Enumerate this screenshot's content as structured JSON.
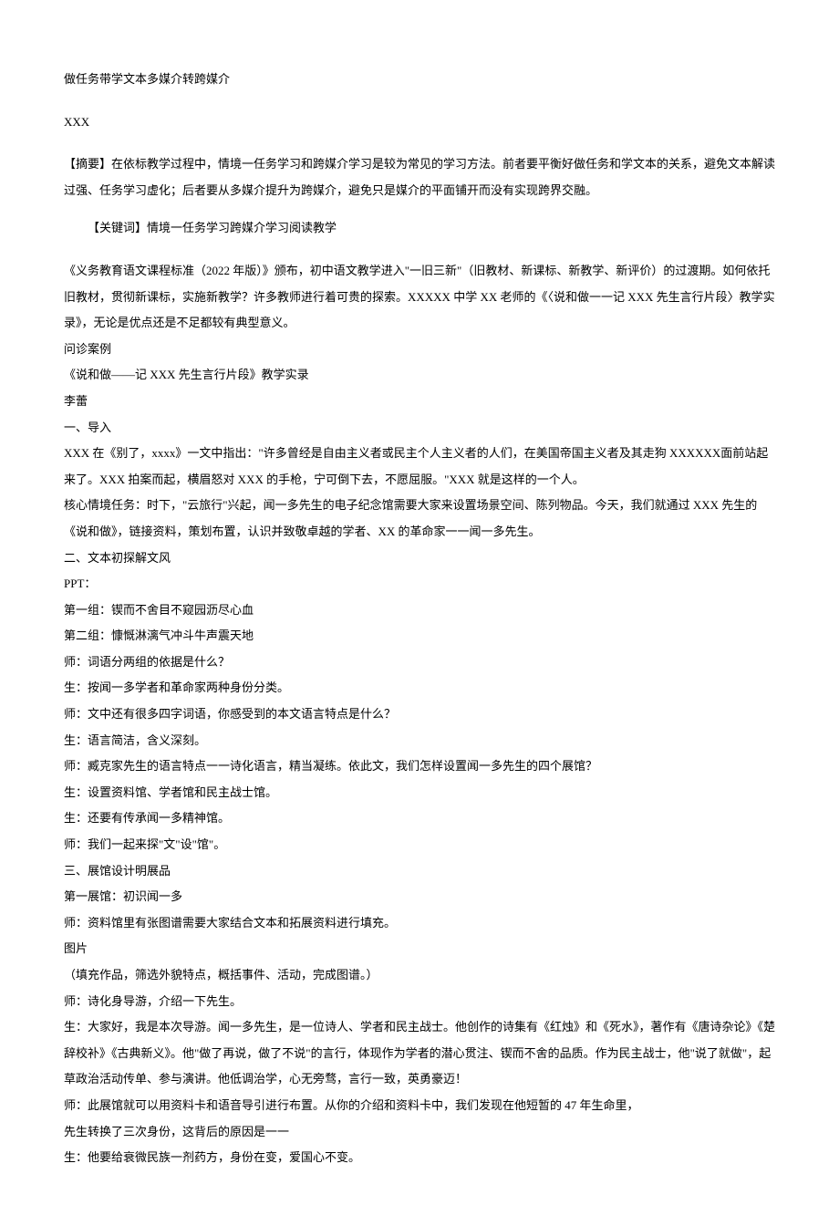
{
  "title": "做任务带学文本多媒介转跨媒介",
  "author": "XXX",
  "abstract": "【摘要】在依标教学过程中，情境一任务学习和跨媒介学习是较为常见的学习方法。前者要平衡好做任务和学文本的关系，避免文本解读过强、任务学习虚化；后者要从多媒介提升为跨媒介，避免只是媒介的平面铺开而没有实现跨界交融。",
  "keywords": "【关键词】情境一任务学习跨媒介学习阅读教学",
  "body": [
    "《义务教育语文课程标准（2022 年版）》颁布，初中语文教学进入\"一旧三新\"（旧教材、新课标、新教学、新评价）的过渡期。如何依托旧教材，贯彻新课标，实施新教学？许多教师进行着可贵的探索。XXXXX 中学 XX 老师的《〈说和做一一记 XXX 先生言行片段〉教学实录》，无论是优点还是不足都较有典型意义。",
    "问诊案例",
    "《说和做——记 XXX 先生言行片段》教学实录",
    "李蕾",
    "一、导入",
    "XXX 在《别了，xxxx》一文中指出：\"许多曾经是自由主义者或民主个人主义者的人们，在美国帝国主义者及其走狗 XXXXXX面前站起来了。XXX 拍案而起，横眉怒对 XXX 的手枪，宁可倒下去，不愿屈服。\"XXX 就是这样的一个人。",
    "核心情境任务：时下，\"云旅行\"兴起，闻一多先生的电子纪念馆需要大家来设置场景空间、陈列物品。今天，我们就通过 XXX 先生的《说和做》，链接资料，策划布置，认识并致敬卓越的学者、XX 的革命家一一闻一多先生。",
    "二、文本初探解文风",
    "PPT：",
    "第一组：锲而不舍目不窥园沥尽心血",
    "第二组：慷慨淋漓气冲斗牛声震天地",
    "师：词语分两组的依据是什么？",
    "生：按闻一多学者和革命家两种身份分类。",
    "师：文中还有很多四字词语，你感受到的本文语言特点是什么？",
    "生：语言简洁，含义深刻。",
    "师：臧克家先生的语言特点一一诗化语言，精当凝练。依此文，我们怎样设置闻一多先生的四个展馆？",
    "生：设置资料馆、学者馆和民主战士馆。",
    "生：还要有传承闻一多精神馆。",
    "师：我们一起来探\"文\"设\"馆\"。",
    "三、展馆设计明展品",
    "第一展馆：初识闻一多",
    "师：资料馆里有张图谱需要大家结合文本和拓展资料进行填充。",
    "图片",
    "（填充作品，筛选外貌特点，概括事件、活动，完成图谱。）",
    "师：诗化身导游，介绍一下先生。",
    "生：大家好，我是本次导游。闻一多先生，是一位诗人、学者和民主战士。他创作的诗集有《红烛》和《死水》，著作有《唐诗杂论》《楚辞校补》《古典新义》。他\"做了再说，做了不说\"的言行，体现作为学者的潜心贯注、锲而不舍的品质。作为民主战士，他\"说了就做\"，起草政治活动传单、参与演讲。他低调治学，心无旁骛，言行一致，英勇豪迈！",
    "师：此展馆就可以用资料卡和语音导引进行布置。从你的介绍和资料卡中，我们发现在他短暂的 47 年生命里，",
    "先生转换了三次身份，这背后的原因是一一",
    "生：他要给衰微民族一剂药方，身份在变，爱国心不变。"
  ]
}
